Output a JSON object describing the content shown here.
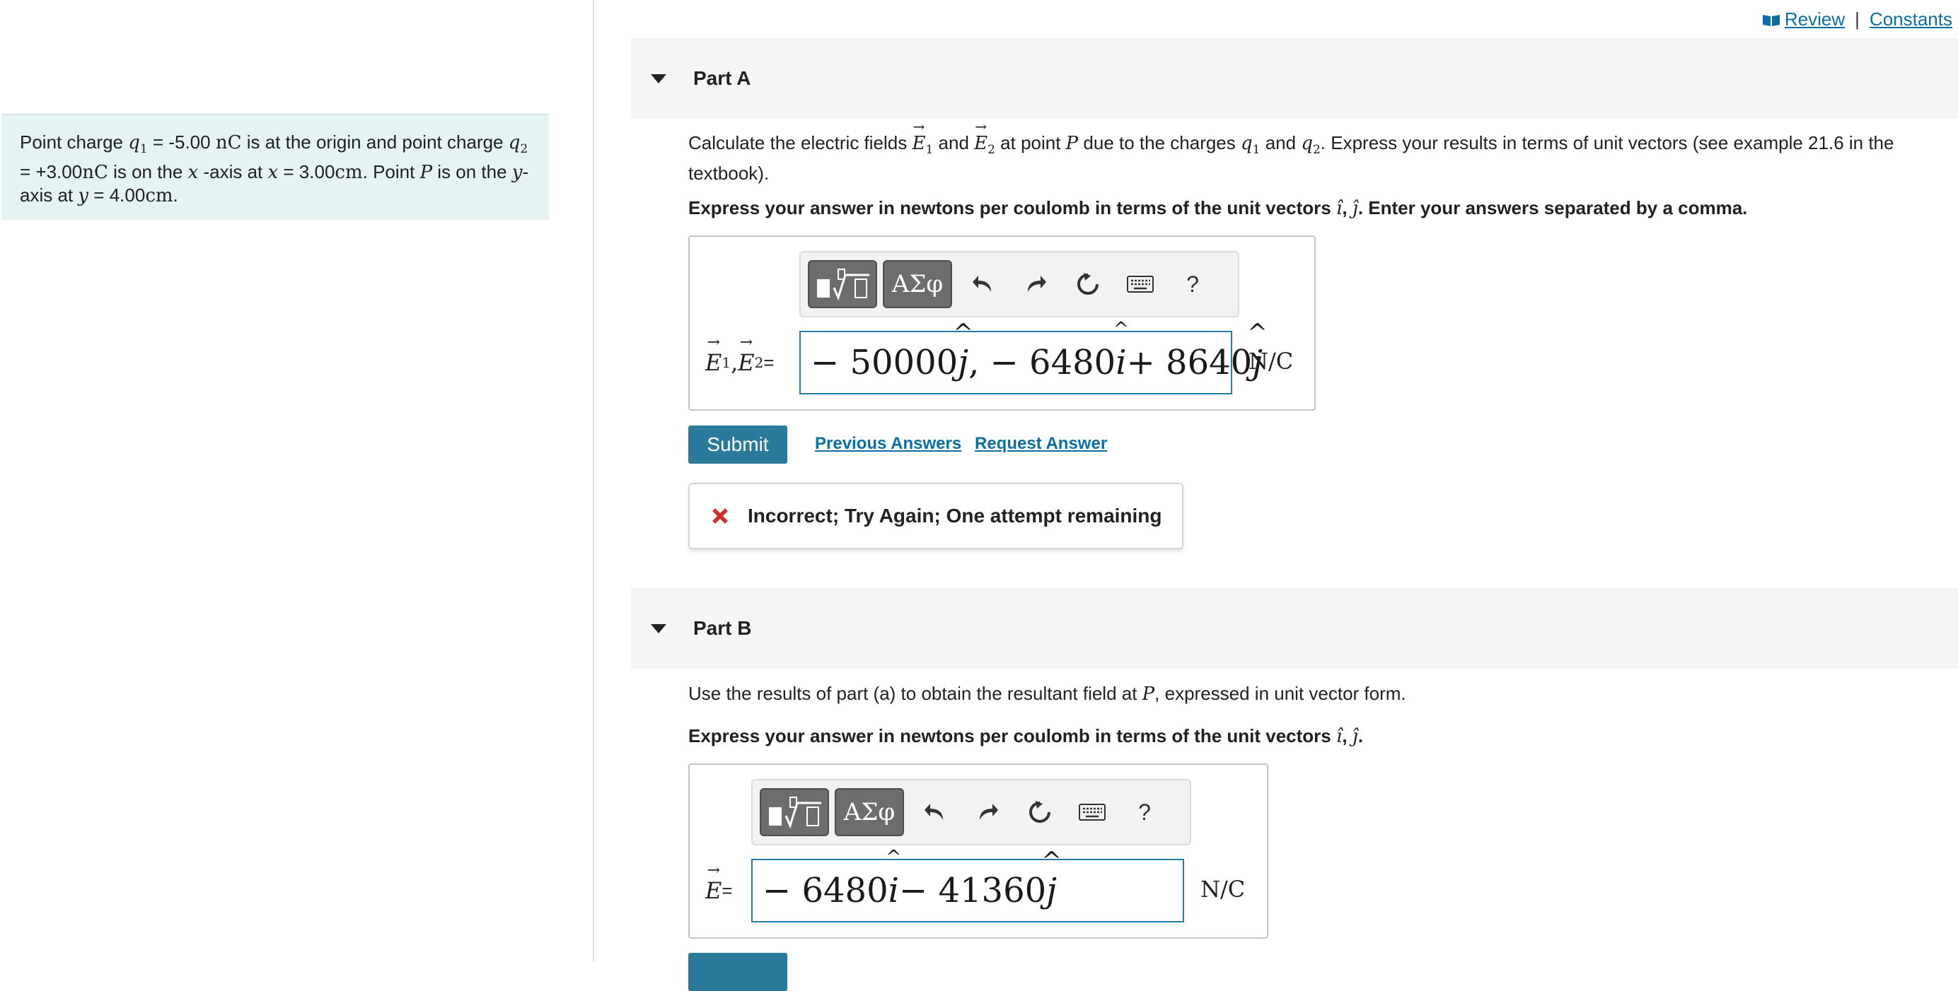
{
  "header": {
    "review_label": "Review",
    "constants_label": "Constants"
  },
  "problem": {
    "t1": "Point charge ",
    "q1": "q",
    "q1_sub": "1",
    "t2": " = -5.00 ",
    "u1": "nC",
    "t3": " is at the origin and point charge ",
    "q2": "q",
    "q2_sub": "2",
    "t4": " = +3.00",
    "u2": "nC",
    "t5": " is on the ",
    "x1": "x",
    "t6": " -axis at ",
    "x2": "x",
    "t7": " = 3.00",
    "u3": "cm",
    "t8": ". Point ",
    "p": "P",
    "t9": " is on the ",
    "y1": "y",
    "t10": "-axis at ",
    "y2": "y",
    "t11": " = 4.00",
    "u4": "cm",
    "t12": "."
  },
  "part_a": {
    "title": "Part A",
    "q_t1": "Calculate the electric fields ",
    "E": "E",
    "s1": "1",
    "q_t2": " and ",
    "s2": "2",
    "q_t3": " at point ",
    "P": "P",
    "q_t4": " due to the charges ",
    "q": "q",
    "q_t5": " and ",
    "q_t6": ". Express your results in terms of unit vectors (see example 21.6 in the textbook).",
    "instr1": "Express your answer in newtons per coulomb in terms of the unit vectors ",
    "i_hat": "î",
    "comma": ", ",
    "j_hat": "ĵ",
    "instr2": ". Enter your answers separated by a comma.",
    "label_E": "E",
    "label_sep": ", ",
    "label_eq": " =",
    "answer": {
      "p1": "− 50000",
      "j1": "j",
      "p2": ", − 6480",
      "i1": "i",
      "p3": " + 8640",
      "j2": "j"
    },
    "unit": "N/C",
    "submit_label": "Submit",
    "previous_answers": "Previous Answers",
    "request_answer": "Request Answer",
    "feedback": "Incorrect; Try Again; One attempt remaining"
  },
  "part_b": {
    "title": "Part B",
    "q_t1": "Use the results of part (a) to obtain the resultant field at ",
    "P": "P",
    "q_t2": ", expressed in unit vector form.",
    "instr1": "Express your answer in newtons per coulomb in terms of the unit vectors ",
    "instr2": ".",
    "label_E": "E",
    "label_eq": " =",
    "answer": {
      "p1": "− 6480",
      "i1": "i",
      "p2": " − 41360",
      "j1": "j"
    },
    "unit": "N/C"
  },
  "toolbar": {
    "templates_icon": "templates-icon",
    "greek_label": "ΑΣφ",
    "undo_icon": "undo-icon",
    "redo_icon": "redo-icon",
    "reset_icon": "reset-icon",
    "keyboard_icon": "keyboard-icon",
    "help_label": "?"
  },
  "colors": {
    "accent": "#2b7a9a",
    "link": "#0b6fa4",
    "problem_bg": "#e5f3f3",
    "error": "#d0312d"
  }
}
